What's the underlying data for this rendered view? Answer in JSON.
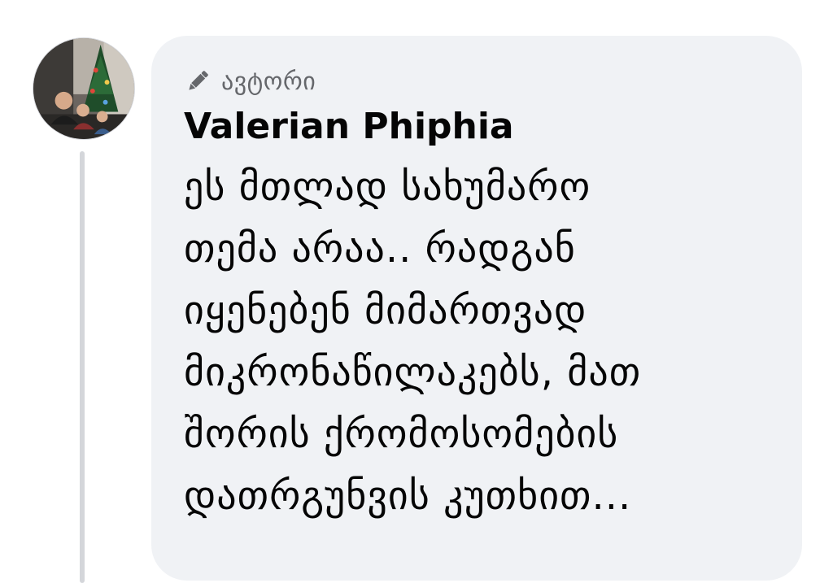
{
  "comment": {
    "badge": {
      "icon": "pencil-icon",
      "label": "ავტორი"
    },
    "author_name": "Valerian Phiphia",
    "text_lines": [
      "ეს მთლად სახუმარო",
      "თემა არაა.. რადგან",
      "იყენებენ მიმართვად",
      "მიკრონაწილაკებს, მათ",
      "შორის ქრომოსომების",
      "დათრგუნვის კუთხით..."
    ]
  },
  "colors": {
    "bubble_bg": "#f0f2f5",
    "text": "#050505",
    "secondary_text": "#65676b",
    "thread_line": "#d4d6da"
  }
}
